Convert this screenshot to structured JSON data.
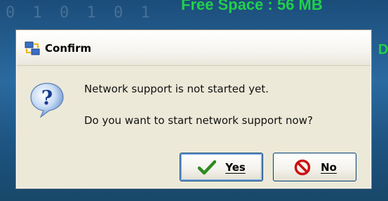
{
  "background": {
    "digits": "0 1 0 1 0 1",
    "free_space_text": "Free Space : 56 MB",
    "edge_text": "DI"
  },
  "dialog": {
    "title": "Confirm",
    "message_line1": "Network support is not started yet.",
    "message_line2": "Do you want to start network support now?",
    "buttons": {
      "yes": "Yes",
      "no": "No"
    }
  },
  "colors": {
    "accent": "#003c74",
    "yes_check": "#2e8b1f",
    "no_stop": "#cc1111",
    "dialog_bg": "#ece9d8"
  }
}
